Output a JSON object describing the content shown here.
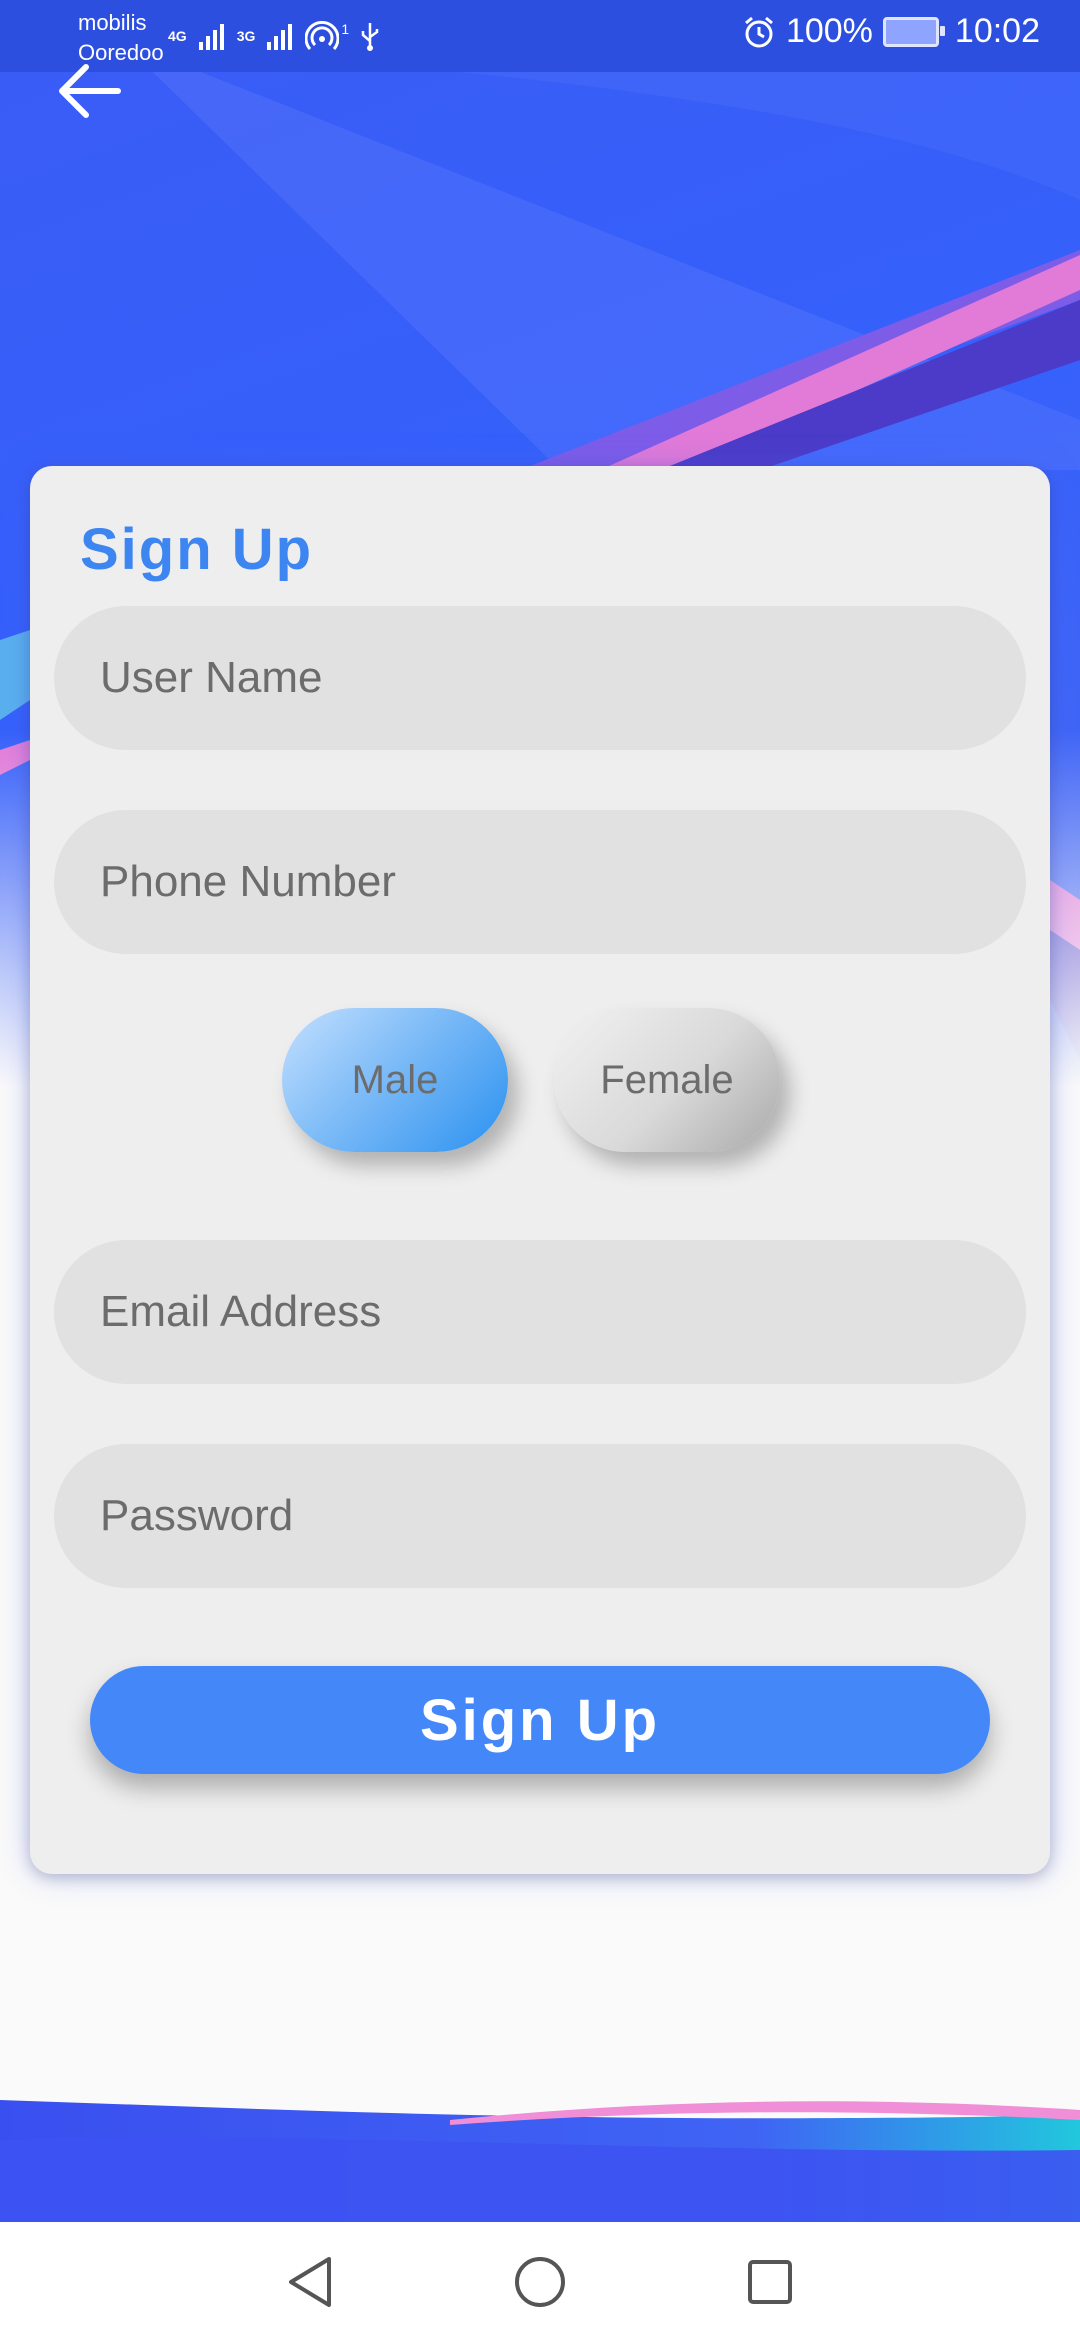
{
  "status_bar": {
    "carrier_1": "mobilis",
    "carrier_2": "Ooredoo",
    "network_1": "4G",
    "network_2": "3G",
    "hotspot_count": "1",
    "battery": "100%",
    "time": "10:02"
  },
  "form": {
    "title": "Sign Up",
    "username_placeholder": "User Name",
    "phone_placeholder": "Phone Number",
    "gender_options": [
      "Male",
      "Female"
    ],
    "gender_selected": "Male",
    "email_placeholder": "Email Address",
    "password_placeholder": "Password",
    "submit_label": "Sign Up"
  },
  "colors": {
    "primary": "#4387f8",
    "title": "#3d85f0",
    "background_blue": "#3560fb",
    "accent_pink": "#e27ad8"
  },
  "icons": {
    "back": "arrow-left-icon",
    "alarm": "alarm-icon",
    "usb": "usb-icon",
    "hotspot": "hotspot-icon",
    "nav_back": "triangle-back-icon",
    "nav_home": "circle-home-icon",
    "nav_recents": "square-recents-icon"
  }
}
